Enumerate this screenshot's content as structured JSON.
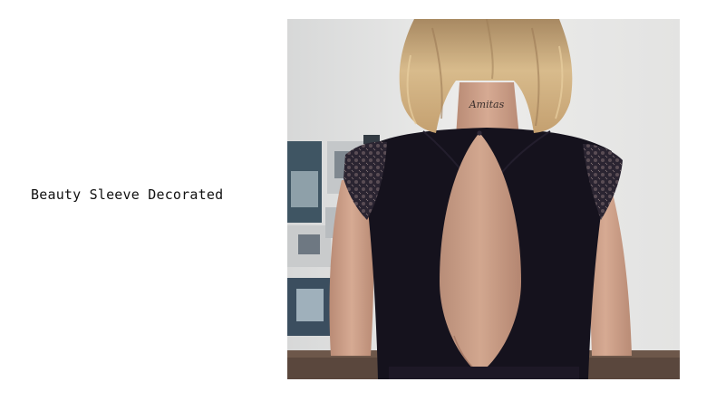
{
  "caption": {
    "text": "Beauty Sleeve Decorated"
  },
  "photo": {
    "tattoo_text": "Amitas",
    "colors": {
      "wall": "#e6e6e4",
      "garment": "#15121d",
      "skin": "#c99c85",
      "hair": "#c9a777",
      "floor": "#4a3a33"
    }
  }
}
